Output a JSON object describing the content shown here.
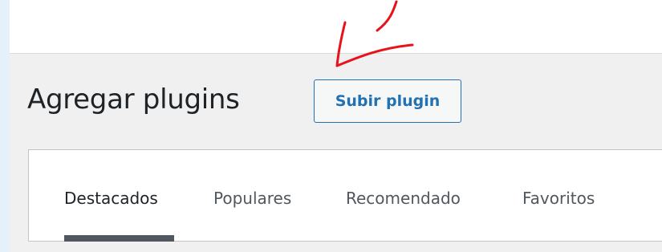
{
  "page": {
    "title": "Agregar plugins",
    "upload_button_label": "Subir plugin"
  },
  "filter_tabs": [
    {
      "label": "Destacados",
      "current": true
    },
    {
      "label": "Populares",
      "current": false
    },
    {
      "label": "Recomendado",
      "current": false
    },
    {
      "label": "Favoritos",
      "current": false
    }
  ],
  "colors": {
    "accent": "#2271b1",
    "annotation": "#e8121b",
    "admin_background": "#f0f0f1"
  }
}
